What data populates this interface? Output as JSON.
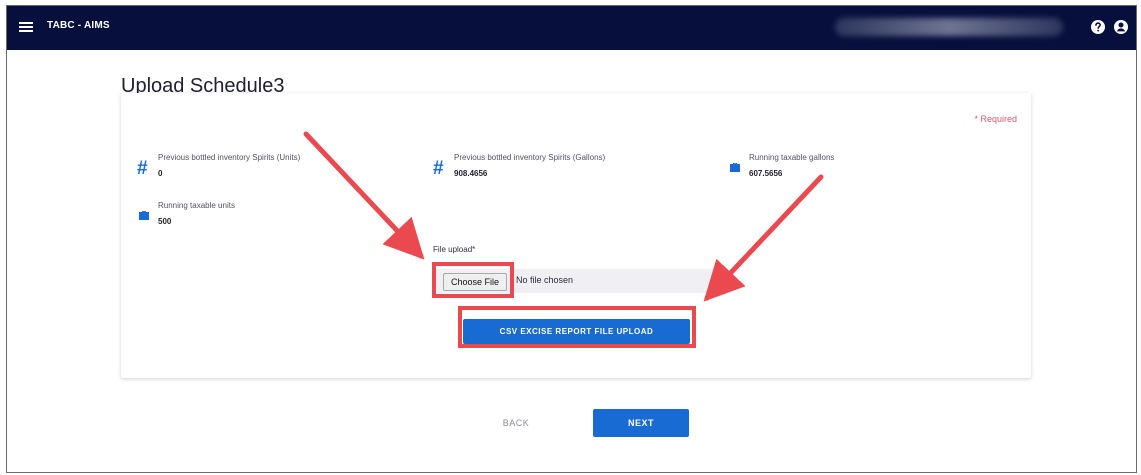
{
  "header": {
    "app_title": "TABC - AIMS",
    "menu_icon": "hamburger-menu-icon",
    "help_icon": "help-icon",
    "account_icon": "account-icon",
    "background_color": "#07103d"
  },
  "page": {
    "title": "Upload Schedule3"
  },
  "card": {
    "required_note": "* Required",
    "metrics": [
      {
        "label": "Previous bottled inventory Spirits (Units)",
        "value": "0",
        "icon": "hash-icon"
      },
      {
        "label": "Previous bottled inventory Spirits (Gallons)",
        "value": "908.4656",
        "icon": "hash-icon"
      },
      {
        "label": "Running taxable gallons",
        "value": "607.5656",
        "icon": "briefcase-icon"
      },
      {
        "label": "Running taxable units",
        "value": "500",
        "icon": "briefcase-icon"
      }
    ],
    "file_upload": {
      "label": "File upload*",
      "choose_file_label": "Choose File",
      "status": "No file chosen"
    },
    "csv_upload_button": "CSV EXCISE REPORT FILE UPLOAD"
  },
  "actions": {
    "back": "BACK",
    "next": "NEXT"
  },
  "colors": {
    "primary": "#176bd2",
    "highlight": "#ea4a4f",
    "required": "#d55a6a"
  }
}
